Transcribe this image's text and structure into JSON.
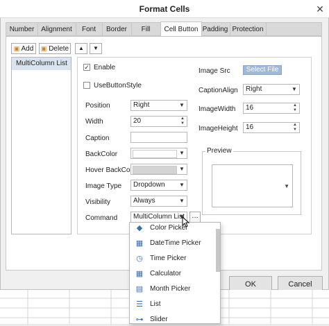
{
  "dialog": {
    "title": "Format Cells",
    "close_glyph": "✕"
  },
  "tabs": [
    {
      "label": "Number"
    },
    {
      "label": "Alignment"
    },
    {
      "label": "Font"
    },
    {
      "label": "Border"
    },
    {
      "label": "Fill"
    },
    {
      "label": "Cell Button"
    },
    {
      "label": "Padding"
    },
    {
      "label": "Protection"
    }
  ],
  "active_tab": "Cell Button",
  "toolbar": {
    "add_label": "Add",
    "delete_label": "Delete",
    "up_glyph": "▲",
    "down_glyph": "▼"
  },
  "buttons_list": {
    "items": [
      "MultiColumn List"
    ],
    "selected": "MultiColumn List"
  },
  "props": {
    "enable_label": "Enable",
    "enable_checked": true,
    "check_glyph": "✓",
    "use_button_style_label": "UseButtonStyle",
    "use_button_style_checked": false,
    "position_label": "Position",
    "position_value": "Right",
    "width_label": "Width",
    "width_value": "20",
    "caption_label": "Caption",
    "caption_value": "",
    "backcolor_label": "BackColor",
    "backcolor_value": "#ffffff",
    "hover_backcolor_label": "Hover BackColor",
    "hover_backcolor_value": "#d4d4d4",
    "image_type_label": "Image Type",
    "image_type_value": "Dropdown",
    "visibility_label": "Visibility",
    "visibility_value": "Always",
    "command_label": "Command",
    "command_value": "MultiColumn List",
    "command_more_glyph": "…",
    "image_src_label": "Image Src",
    "select_file_label": "Select File",
    "caption_align_label": "CaptionAlign",
    "caption_align_value": "Right",
    "image_width_label": "ImageWidth",
    "image_width_value": "16",
    "image_height_label": "ImageHeight",
    "image_height_value": "16",
    "preview_label": "Preview"
  },
  "command_dropdown": {
    "items": [
      {
        "label": "Color Picker",
        "icon": "color-picker-icon",
        "glyph": "◆"
      },
      {
        "label": "DateTime Picker",
        "icon": "calendar-icon",
        "glyph": "▦"
      },
      {
        "label": "Time Picker",
        "icon": "clock-icon",
        "glyph": "◷"
      },
      {
        "label": "Calculator",
        "icon": "calculator-icon",
        "glyph": "▦"
      },
      {
        "label": "Month Picker",
        "icon": "month-icon",
        "glyph": "▤"
      },
      {
        "label": "List",
        "icon": "list-icon",
        "glyph": "☰"
      },
      {
        "label": "Slider",
        "icon": "slider-icon",
        "glyph": "⊶"
      }
    ]
  },
  "footer": {
    "ok_label": "OK",
    "cancel_label": "Cancel"
  },
  "arrow_glyph": "▼"
}
